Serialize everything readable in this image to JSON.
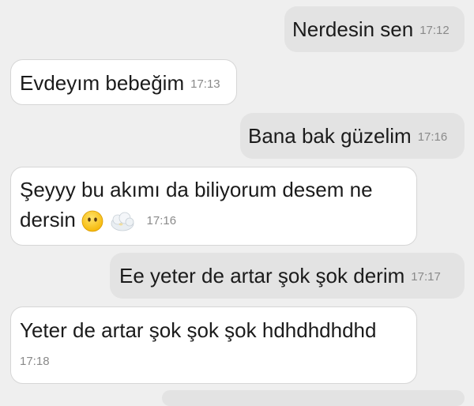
{
  "messages": [
    {
      "direction": "out",
      "text": "Nerdesin sen",
      "time": "17:12"
    },
    {
      "direction": "in",
      "text": "Evdeyım bebeğim",
      "time": "17:13"
    },
    {
      "direction": "out",
      "text": "Bana bak güzelim",
      "time": "17:16"
    },
    {
      "direction": "in",
      "text_line1": "Şeyyy bu akımı da biliyorum desem ne",
      "text_line2": "dersin",
      "time": "17:16",
      "emojis": [
        "no-mouth-face-emoji",
        "face-in-clouds-emoji"
      ]
    },
    {
      "direction": "out",
      "text": "Ee yeter de artar şok şok derim",
      "time": "17:17"
    },
    {
      "direction": "in",
      "text": "Yeter de artar şok şok şok hdhdhdhdhd",
      "time": "17:18"
    }
  ]
}
